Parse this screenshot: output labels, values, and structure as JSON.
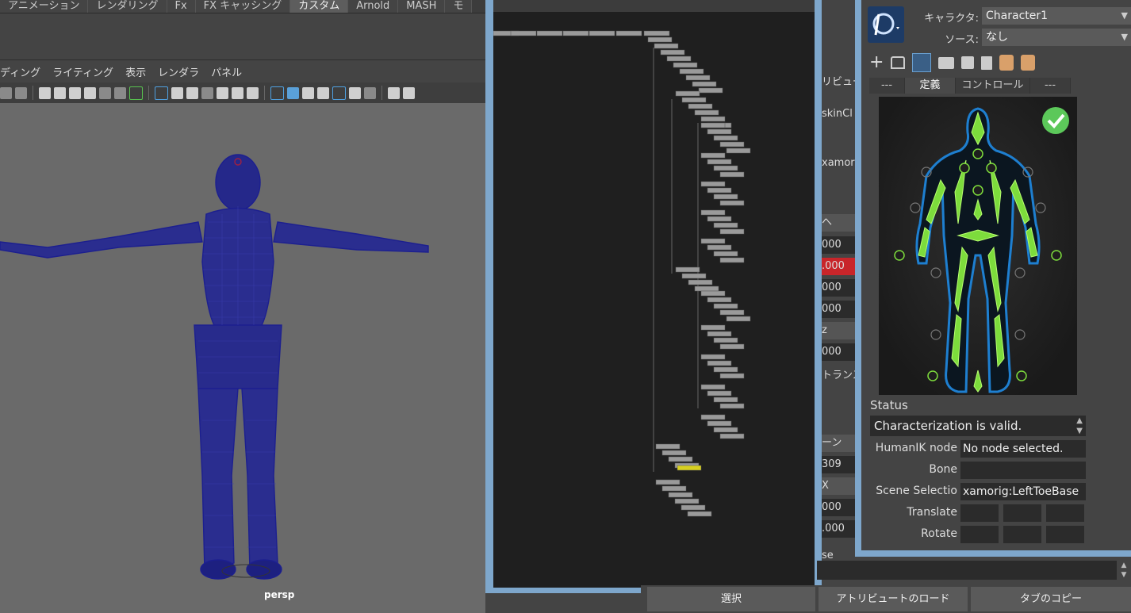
{
  "shelf_tabs": [
    "アニメーション",
    "レンダリング",
    "Fx",
    "FX キャッシング",
    "カスタム",
    "Arnold",
    "MASH",
    "モ"
  ],
  "active_shelf_tab": "カスタム",
  "viewport_menu": [
    "ディング",
    "ライティング",
    "表示",
    "レンダラ",
    "パネル"
  ],
  "viewport": {
    "camera_label": "persp"
  },
  "attribute_editor": {
    "labels": [
      "リビュー",
      "skinCl",
      "xamor",
      "へ",
      "トランス",
      "ーン",
      "X",
      "se"
    ],
    "values": [
      "000",
      ".000",
      "000",
      "000",
      "z",
      "000",
      "309",
      "000",
      ".000"
    ],
    "highlight_color": "#c8252a"
  },
  "hik": {
    "character_label": "キャラクタ:",
    "character_value": "Character1",
    "source_label": "ソース:",
    "source_value": "なし",
    "tabs": [
      "---",
      "定義",
      "コントロール",
      "---"
    ],
    "active_tab": "定義",
    "status_label": "Status",
    "status_value": "Characterization is valid.",
    "humanik_node_label": "HumanIK node",
    "humanik_node_value": "No node selected.",
    "bone_label": "Bone",
    "bone_value": "",
    "scene_selection_label": "Scene Selectio",
    "scene_selection_value": "xamorig:LeftToeBase",
    "translate_label": "Translate",
    "rotate_label": "Rotate",
    "valid_color": "#5cc85a"
  },
  "bottom_buttons": [
    "選択",
    "アトリビュートのロード",
    "タブのコピー"
  ],
  "icons": [
    "camera-icon",
    "bookmark-icon",
    "grid-icon",
    "wireframe-icon",
    "shaded-icon",
    "light-icon",
    "hik-logo-icon",
    "add-icon",
    "lock-icon",
    "folder-icon",
    "save-icon",
    "delete-icon",
    "check-icon"
  ]
}
